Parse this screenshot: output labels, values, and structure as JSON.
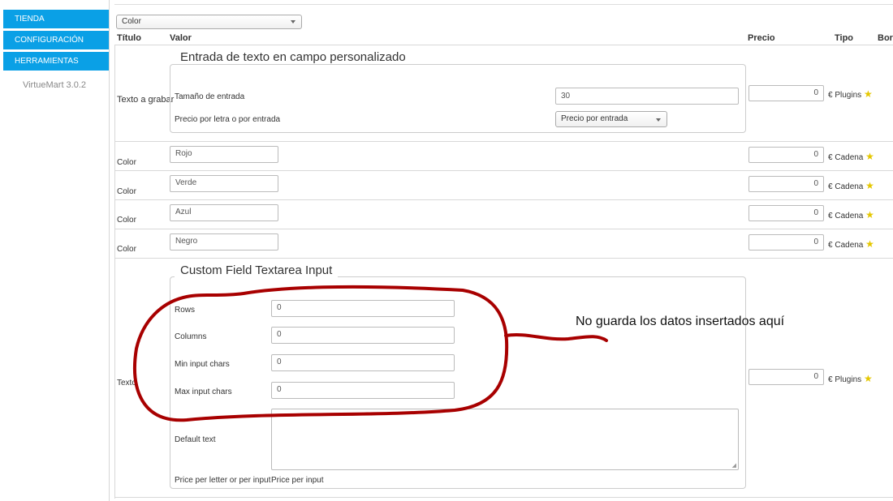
{
  "sidebar": {
    "items": [
      {
        "label": "TIENDA"
      },
      {
        "label": "CONFIGURACIÓN"
      },
      {
        "label": "HERRAMIENTAS"
      }
    ],
    "version": "VirtueMart 3.0.2"
  },
  "field_select": {
    "value": "Color"
  },
  "table_headers": {
    "titulo": "Título",
    "valor": "Valor",
    "precio": "Precio",
    "tipo": "Tipo",
    "borrar": "Borr"
  },
  "text_input_block": {
    "row_title": "Texto a grabar",
    "legend": "Entrada de texto en campo personalizado",
    "size_label": "Tamaño de entrada",
    "size_value": "30",
    "price_mode_label": "Precio por letra o por entrada",
    "price_mode_value": "Precio por entrada",
    "price": "0",
    "currency": "€",
    "type": "Plugins"
  },
  "color_rows": [
    {
      "title": "Color",
      "value": "Rojo",
      "price": "0",
      "currency": "€",
      "type": "Cadena"
    },
    {
      "title": "Color",
      "value": "Verde",
      "price": "0",
      "currency": "€",
      "type": "Cadena"
    },
    {
      "title": "Color",
      "value": "Azul",
      "price": "0",
      "currency": "€",
      "type": "Cadena"
    },
    {
      "title": "Color",
      "value": "Negro",
      "price": "0",
      "currency": "€",
      "type": "Cadena"
    }
  ],
  "textarea_block": {
    "row_title": "Texto",
    "legend": "Custom Field Textarea Input",
    "rows_label": "Rows",
    "rows_value": "0",
    "columns_label": "Columns",
    "columns_value": "0",
    "min_label": "Min input chars",
    "min_value": "0",
    "max_label": "Max input chars",
    "max_value": "0",
    "default_text_label": "Default text",
    "price_mode_label": "Price per letter or per input",
    "price_mode_value": "Price per input",
    "price": "0",
    "currency": "€",
    "type": "Plugins"
  },
  "annotation": {
    "text": "No guarda los datos insertados aquí",
    "color": "#a80000"
  }
}
